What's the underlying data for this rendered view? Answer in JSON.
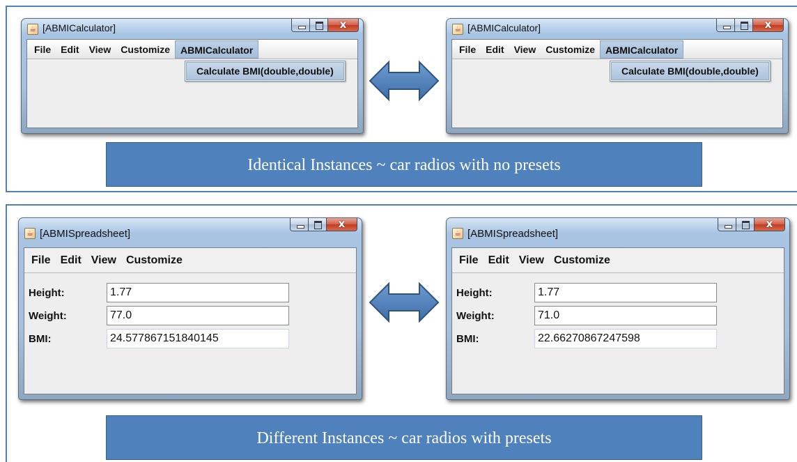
{
  "top": {
    "caption": "Identical Instances ~ car radios with no presets",
    "left_window": {
      "title": "[ABMICalculator]",
      "menu": [
        "File",
        "Edit",
        "View",
        "Customize",
        "ABMICalculator"
      ],
      "dropdown_item": "Calculate BMI(double,double)"
    },
    "right_window": {
      "title": "[ABMICalculator]",
      "menu": [
        "File",
        "Edit",
        "View",
        "Customize",
        "ABMICalculator"
      ],
      "dropdown_item": "Calculate BMI(double,double)"
    }
  },
  "bottom": {
    "caption": "Different Instances ~ car radios with presets",
    "left_window": {
      "title": "[ABMISpreadsheet]",
      "menu": [
        "File",
        "Edit",
        "View",
        "Customize"
      ],
      "fields": [
        {
          "label": "Height:",
          "value": "1.77"
        },
        {
          "label": "Weight:",
          "value": "77.0"
        },
        {
          "label": "BMI:",
          "value": "24.577867151840145"
        }
      ]
    },
    "right_window": {
      "title": "[ABMISpreadsheet]",
      "menu": [
        "File",
        "Edit",
        "View",
        "Customize"
      ],
      "fields": [
        {
          "label": "Height:",
          "value": "1.77"
        },
        {
          "label": "Weight:",
          "value": "71.0"
        },
        {
          "label": "BMI:",
          "value": "22.66270867247598"
        }
      ]
    }
  },
  "icons": {
    "window_icon": "java-cup-icon",
    "arrow": "double-headed-arrow-icon"
  },
  "colors": {
    "accent": "#4f81bd",
    "accent_border": "#385d8a",
    "caption_text": "#ffffff"
  }
}
